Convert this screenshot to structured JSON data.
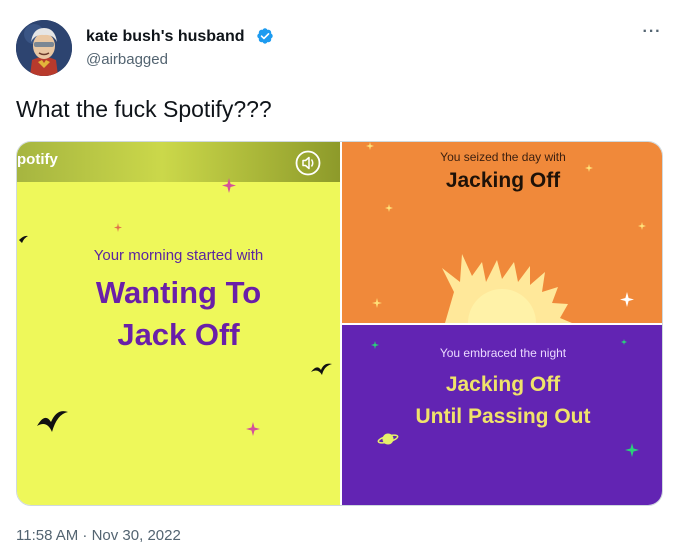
{
  "author": {
    "display_name": "kate bush's husband",
    "handle": "@airbagged"
  },
  "tweet": {
    "text": "What the fuck Spotify???",
    "timestamp": "11:58 AM · Nov 30, 2022"
  },
  "icons": {
    "more": "more-options-icon",
    "verified": "verified-badge-icon",
    "speaker": "speaker-icon"
  },
  "media": {
    "morning": {
      "logo": "potify",
      "subtitle": "Your morning started with",
      "line1": "Wanting To",
      "line2": "Jack Off",
      "background": "#eef85a"
    },
    "day": {
      "subtitle": "You seized the day with",
      "title": "Jacking Off",
      "background": "#f0893a"
    },
    "night": {
      "subtitle": "You embraced the night",
      "line1": "Jacking Off",
      "line2": "Until Passing Out",
      "background": "#6224b3"
    }
  },
  "colors": {
    "verified": "#1d9bf0",
    "secondary_text": "#536471",
    "primary_text": "#0f1419"
  }
}
